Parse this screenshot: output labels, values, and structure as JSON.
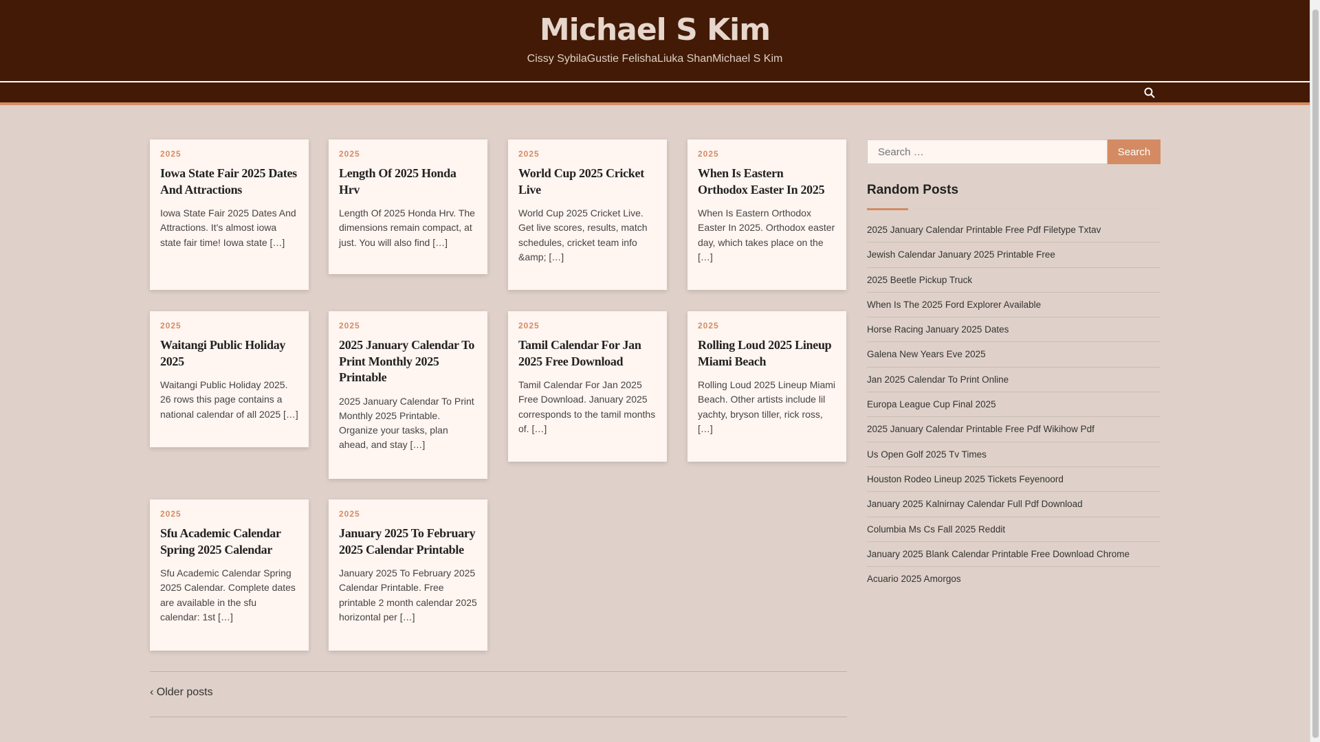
{
  "site": {
    "title": "Michael S Kim",
    "tagline": "Cissy SybilaGustie FelishaLiuka ShanMichael S Kim"
  },
  "posts": [
    {
      "cat": "2025",
      "title": "Iowa State Fair 2025 Dates And Attractions",
      "excerpt": "Iowa State Fair 2025 Dates And Attractions. It's almost iowa state fair time! Iowa state […]"
    },
    {
      "cat": "2025",
      "title": "Length Of 2025 Honda Hrv",
      "excerpt": "Length Of 2025 Honda Hrv. The dimensions remain compact, at just. You will also find […]"
    },
    {
      "cat": "2025",
      "title": "World Cup 2025 Cricket Live",
      "excerpt": "World Cup 2025 Cricket Live. Get live scores, results, match schedules, cricket team info &amp; […]"
    },
    {
      "cat": "2025",
      "title": "When Is Eastern Orthodox Easter In 2025",
      "excerpt": "When Is Eastern Orthodox Easter In 2025. Orthodox easter day, which takes place on the […]"
    },
    {
      "cat": "2025",
      "title": "Waitangi Public Holiday 2025",
      "excerpt": "Waitangi Public Holiday 2025. 26 rows this page contains a national calendar of all 2025 […]"
    },
    {
      "cat": "2025",
      "title": "2025 January Calendar To Print Monthly 2025 Printable",
      "excerpt": "2025 January Calendar To Print Monthly 2025 Printable. Organize your tasks, plan ahead, and stay […]"
    },
    {
      "cat": "2025",
      "title": "Tamil Calendar For Jan 2025 Free Download",
      "excerpt": "Tamil Calendar For Jan 2025 Free Download. January 2025 corresponds to the tamil months of. […]"
    },
    {
      "cat": "2025",
      "title": "Rolling Loud 2025 Lineup Miami Beach",
      "excerpt": "Rolling Loud 2025 Lineup Miami Beach. Other artists include lil yachty, bryson tiller, rick ross, […]"
    },
    {
      "cat": "2025",
      "title": "Sfu Academic Calendar Spring 2025 Calendar",
      "excerpt": "Sfu Academic Calendar Spring 2025 Calendar. Complete dates are available in the sfu calendar: 1st […]"
    },
    {
      "cat": "2025",
      "title": "January 2025 To February 2025 Calendar Printable",
      "excerpt": "January 2025 To February 2025 Calendar Printable. Free printable 2 month calendar 2025 horizontal per […]"
    }
  ],
  "pagination": {
    "older": "Older posts"
  },
  "sidebar": {
    "search_placeholder": "Search …",
    "search_button": "Search",
    "heading": "Random Posts",
    "items": [
      "2025 January Calendar Printable Free Pdf Filetype Txtav",
      "Jewish Calendar January 2025 Printable Free",
      "2025 Beetle Pickup Truck",
      "When Is The 2025 Ford Explorer Available",
      "Horse Racing January 2025 Dates",
      "Galena New Years Eve 2025",
      "Jan 2025 Calendar To Print Online",
      "Europa League Cup Final 2025",
      "2025 January Calendar Printable Free Pdf Wikihow Pdf",
      "Us Open Golf 2025 Tv Times",
      "Houston Rodeo Lineup 2025 Tickets Feyenoord",
      "January 2025 Kalnirnay Calendar Full Pdf Download",
      "Columbia Ms Cs Fall 2025 Reddit",
      "January 2025 Blank Calendar Printable Free Download Chrome",
      "Acuario 2025 Amorgos"
    ]
  },
  "colors": {
    "header": "#421a06",
    "accent": "#d48b63",
    "background": "#dfd1c9",
    "card": "#fff5f1"
  }
}
